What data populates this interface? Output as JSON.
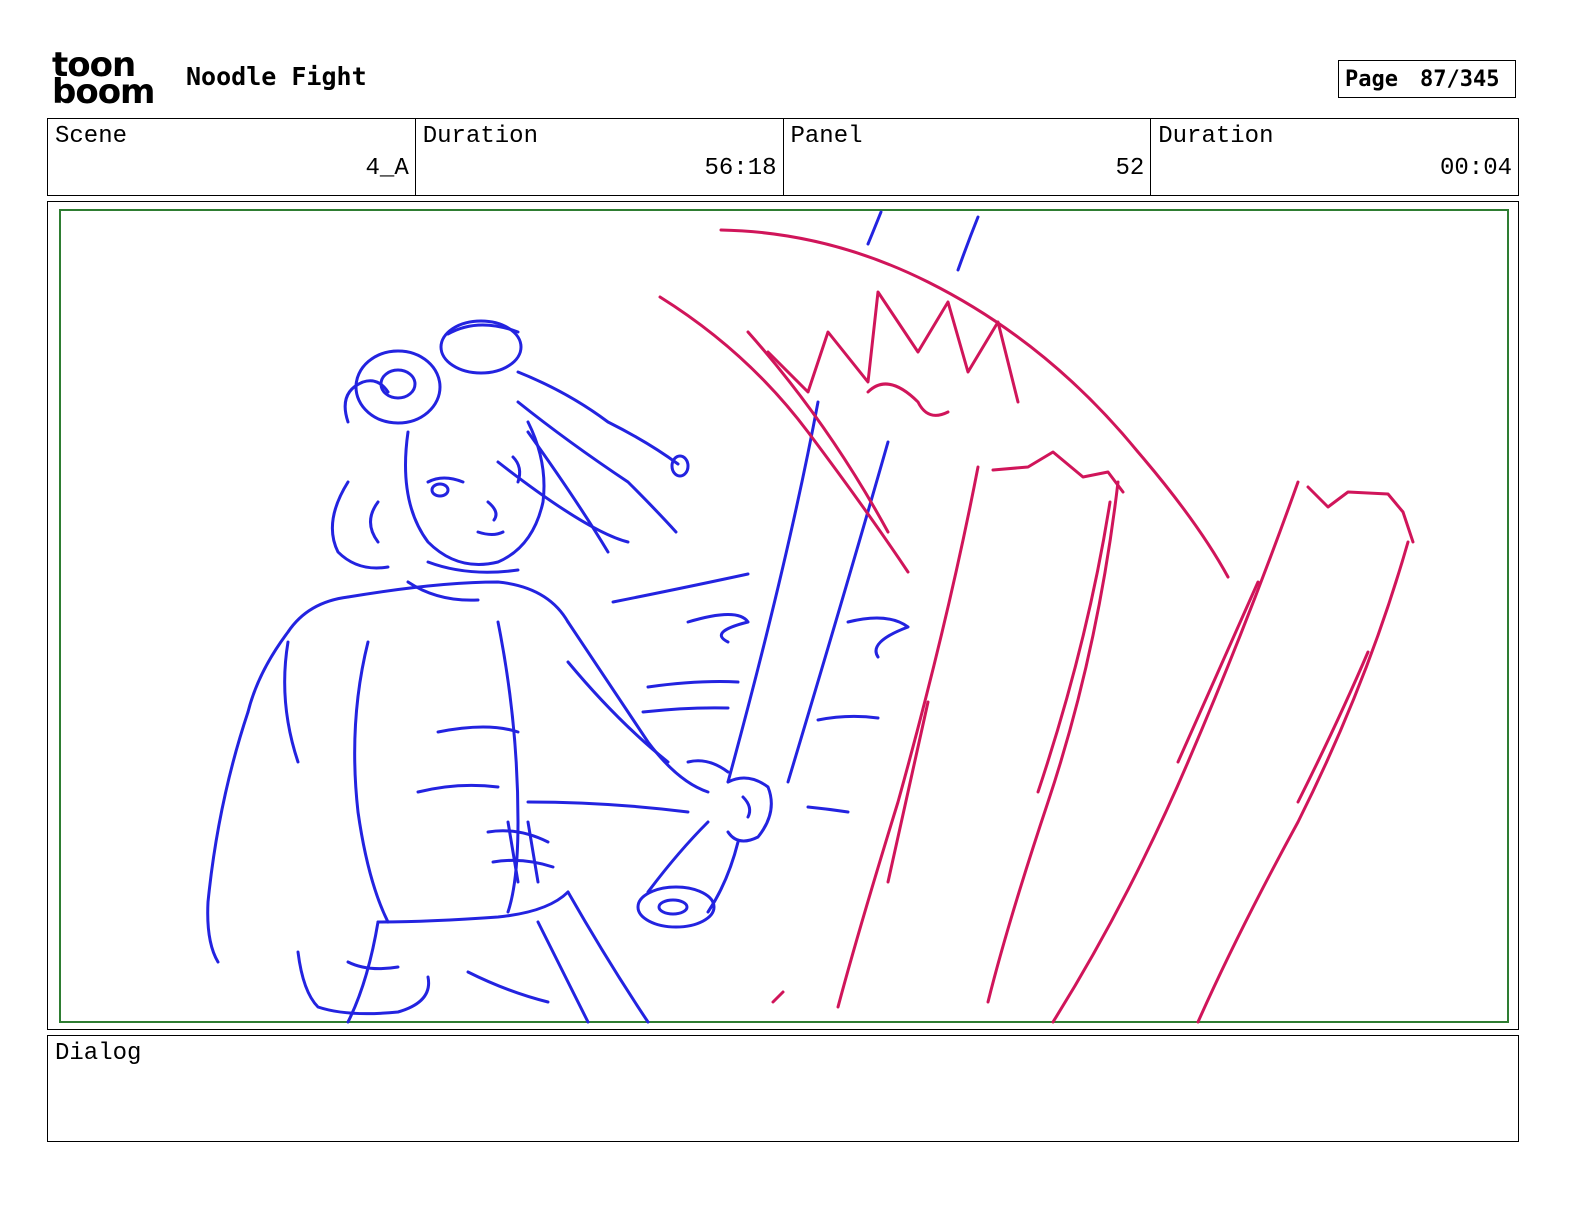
{
  "header": {
    "logo_line1": "toon",
    "logo_line2": "boom",
    "title": "Noodle Fight",
    "page_label": "Page",
    "page_number": "87/345"
  },
  "info": {
    "scene_label": "Scene",
    "scene_value": "4_A",
    "scene_duration_label": "Duration",
    "scene_duration_value": "56:18",
    "panel_label": "Panel",
    "panel_value": "52",
    "panel_duration_label": "Duration",
    "panel_duration_value": "00:04"
  },
  "dialog": {
    "label": "Dialog",
    "text": ""
  },
  "colors": {
    "sketch_blue": "#2323e0",
    "sketch_red": "#d0155a",
    "safe_frame": "#2e7d32"
  }
}
